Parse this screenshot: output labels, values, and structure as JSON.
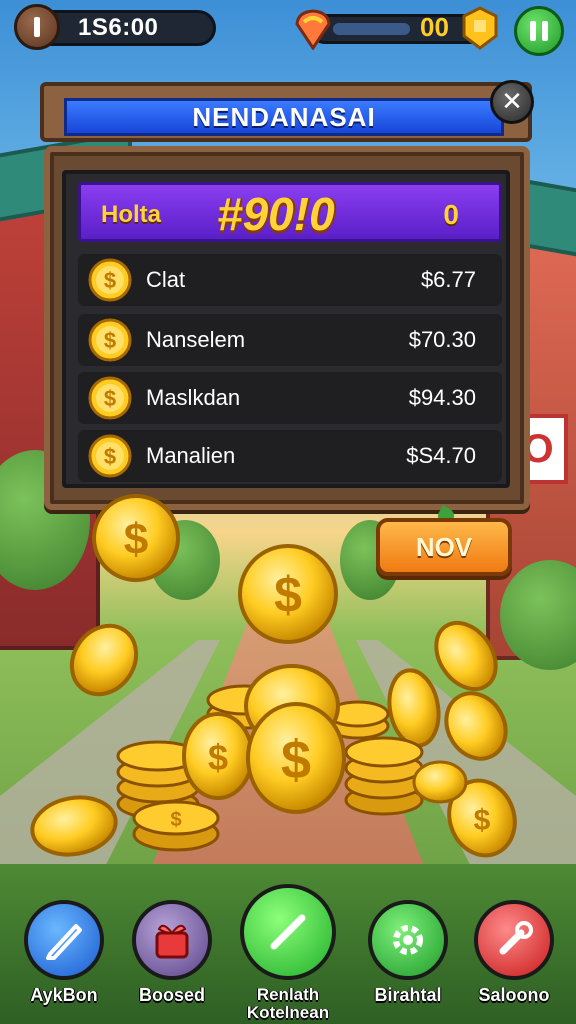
{
  "hud": {
    "money": "1S6:00",
    "gem_count": "00",
    "progress_fraction": 0.55
  },
  "panel": {
    "title": "NENDANASAI",
    "close_label": "✕",
    "total": {
      "label": "Holta",
      "value": "#90!0",
      "count": "0"
    },
    "rows": [
      {
        "name": "Clat",
        "amount": "$6.77"
      },
      {
        "name": "Nanselem",
        "amount": "$70.30"
      },
      {
        "name": "Maslkdan",
        "amount": "$94.30"
      },
      {
        "name": "Manalien",
        "amount": "$S4.70"
      }
    ]
  },
  "nov_button": {
    "label": "NOV"
  },
  "bottom_bar": [
    {
      "label": "AykBon",
      "icon": "pencil-icon"
    },
    {
      "label": "Boosed",
      "icon": "gift-icon"
    },
    {
      "label": "Renlath\nKotelnean",
      "icon": "slash-icon"
    },
    {
      "label": "Birahtal",
      "icon": "gear-icon"
    },
    {
      "label": "Saloono",
      "icon": "wrench-icon"
    }
  ],
  "colors": {
    "panel_title_blue": "#1846d8",
    "total_purple": "#5a1fc8",
    "gold": "#ffd23a",
    "nov_orange": "#f07a12"
  }
}
